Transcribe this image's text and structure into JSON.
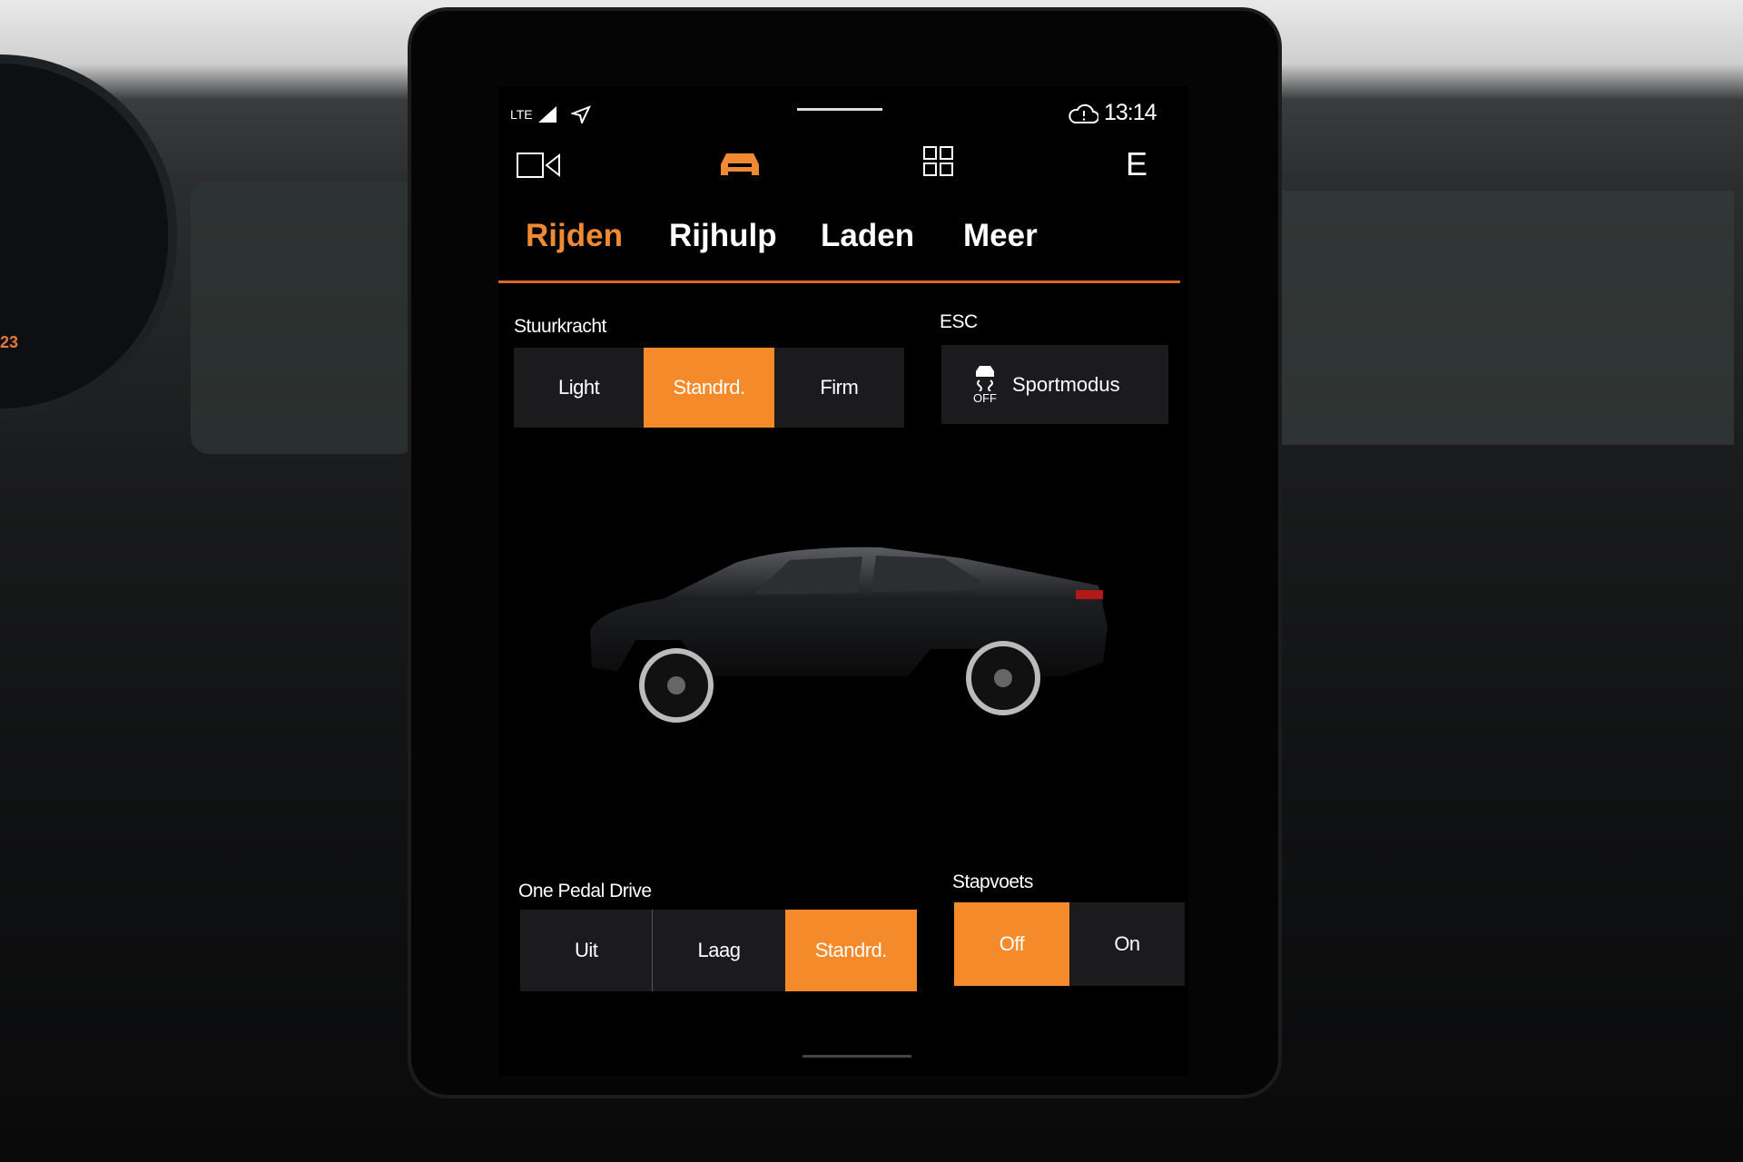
{
  "status_bar": {
    "network": "LTE",
    "time": "13:14"
  },
  "top_icons": [
    {
      "icon": "camera-icon"
    },
    {
      "icon": "car-icon",
      "active": true
    },
    {
      "icon": "apps-grid-icon"
    },
    {
      "icon": "profile-letter",
      "label": "E"
    }
  ],
  "tabs": [
    {
      "label": "Rijden",
      "active": true
    },
    {
      "label": "Rijhulp"
    },
    {
      "label": "Laden"
    },
    {
      "label": "Meer"
    }
  ],
  "steering": {
    "label": "Stuurkracht",
    "options": [
      "Light",
      "Standrd.",
      "Firm"
    ],
    "selected": "Standrd."
  },
  "esc": {
    "label": "ESC",
    "button_label": "Sportmodus",
    "icon_text": "OFF"
  },
  "one_pedal": {
    "label": "One Pedal Drive",
    "options": [
      "Uit",
      "Laag",
      "Standrd."
    ],
    "selected": "Standrd."
  },
  "creep": {
    "label": "Stapvoets",
    "options": [
      "Off",
      "On"
    ],
    "selected": "Off"
  },
  "cluster": {
    "value": "23"
  },
  "colors": {
    "accent": "#f58a2a",
    "panel": "#1b1b1d",
    "background": "#000000"
  }
}
